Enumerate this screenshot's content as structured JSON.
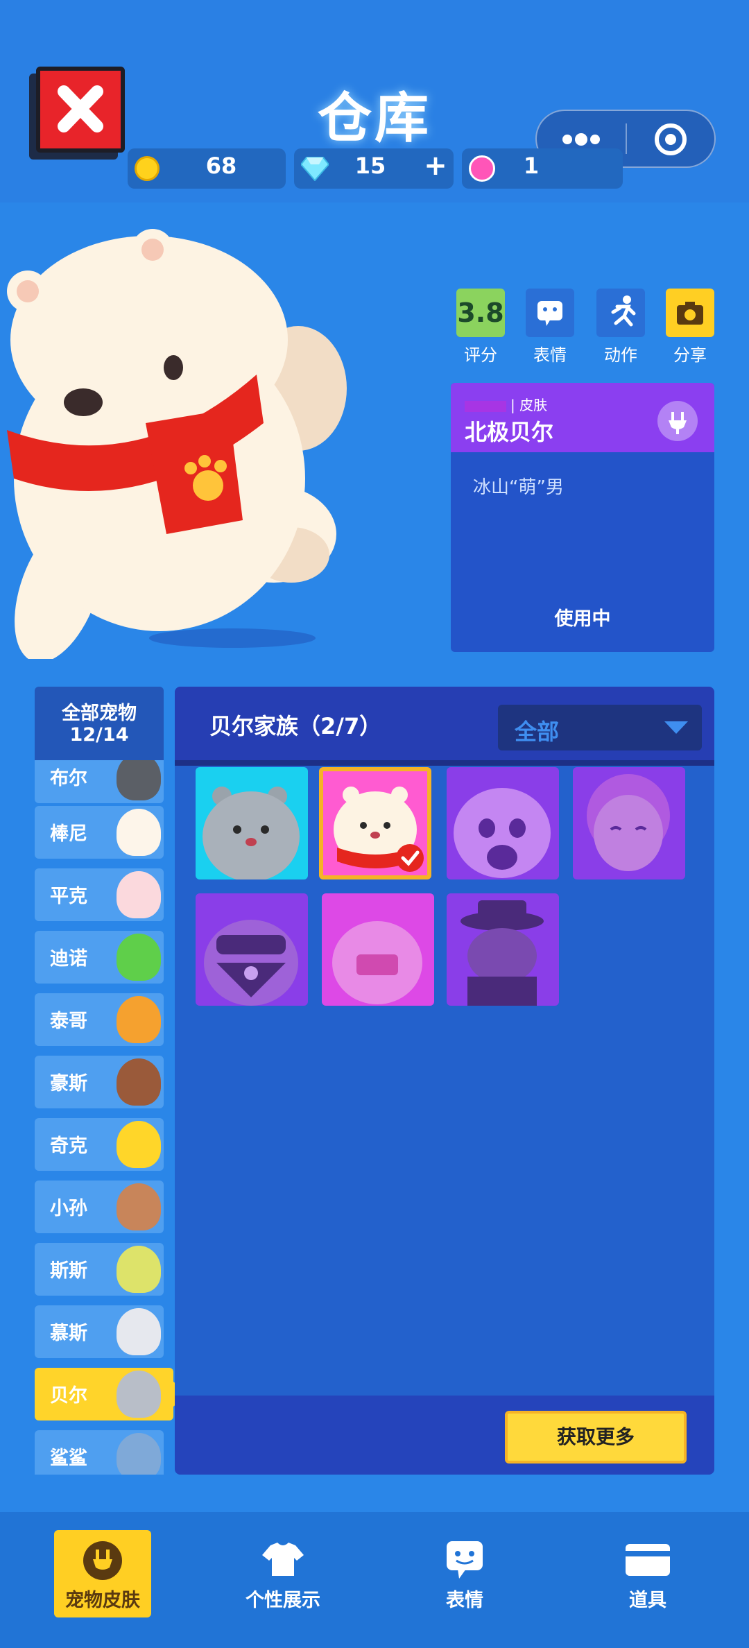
{
  "header": {
    "title": "仓库",
    "coins": "68",
    "gems": "15",
    "gems_add": "+",
    "flowers": "1"
  },
  "actions": {
    "score_value": "3.8",
    "score_label": "评分",
    "emote_label": "表情",
    "motion_label": "动作",
    "share_label": "分享"
  },
  "skin_info": {
    "tag": "皮肤",
    "name": "北极贝尔",
    "description": "冰山“萌”男",
    "status": "使用中"
  },
  "pet_list": {
    "header_title": "全部宠物",
    "header_count": "12/14",
    "items": [
      {
        "label": "布尔"
      },
      {
        "label": "棒尼"
      },
      {
        "label": "平克"
      },
      {
        "label": "迪诺"
      },
      {
        "label": "泰哥"
      },
      {
        "label": "豪斯"
      },
      {
        "label": "奇克"
      },
      {
        "label": "小孙"
      },
      {
        "label": "斯斯"
      },
      {
        "label": "慕斯"
      },
      {
        "label": "贝尔"
      },
      {
        "label": "鲨鲨"
      }
    ]
  },
  "panel": {
    "family_title": "贝尔家族（2/7）",
    "filter_value": "全部",
    "more_button": "获取更多"
  },
  "tabs": {
    "pet_skin": "宠物皮肤",
    "showcase": "个性展示",
    "emote": "表情",
    "items": "道具"
  }
}
